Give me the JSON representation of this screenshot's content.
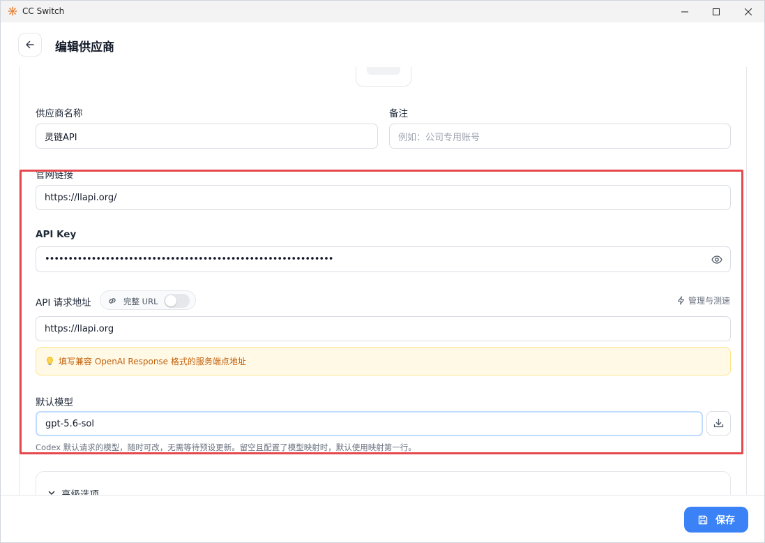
{
  "window": {
    "title": "CC Switch"
  },
  "header": {
    "title": "编辑供应商"
  },
  "form": {
    "provider_name": {
      "label": "供应商名称",
      "value": "灵链API"
    },
    "notes": {
      "label": "备注",
      "placeholder": "例如：公司专用账号"
    },
    "website": {
      "label": "官网链接",
      "value": "https://llapi.org/"
    },
    "api_key": {
      "label": "API Key",
      "value": "••••••••••••••••••••••••••••••••••••••••••••••••••••••••••••••"
    },
    "endpoint": {
      "label": "API 请求地址",
      "full_url_label": "完整 URL",
      "full_url_enabled": false,
      "manage_label": "管理与测速",
      "value": "https://llapi.org",
      "hint": "填写兼容 OpenAI Response 格式的服务端点地址"
    },
    "default_model": {
      "label": "默认模型",
      "value": "gpt-5.6-sol",
      "description": "Codex 默认请求的模型，随时可改，无需等待预设更新。留空且配置了模型映射时，默认使用映射第一行。"
    },
    "advanced": {
      "label": "高级选项"
    }
  },
  "footer": {
    "save_label": "保存"
  },
  "colors": {
    "accent": "#3b82f6",
    "highlight": "#e5484d",
    "hint_bg": "#fff9e6",
    "hint_text": "#c2610c"
  }
}
